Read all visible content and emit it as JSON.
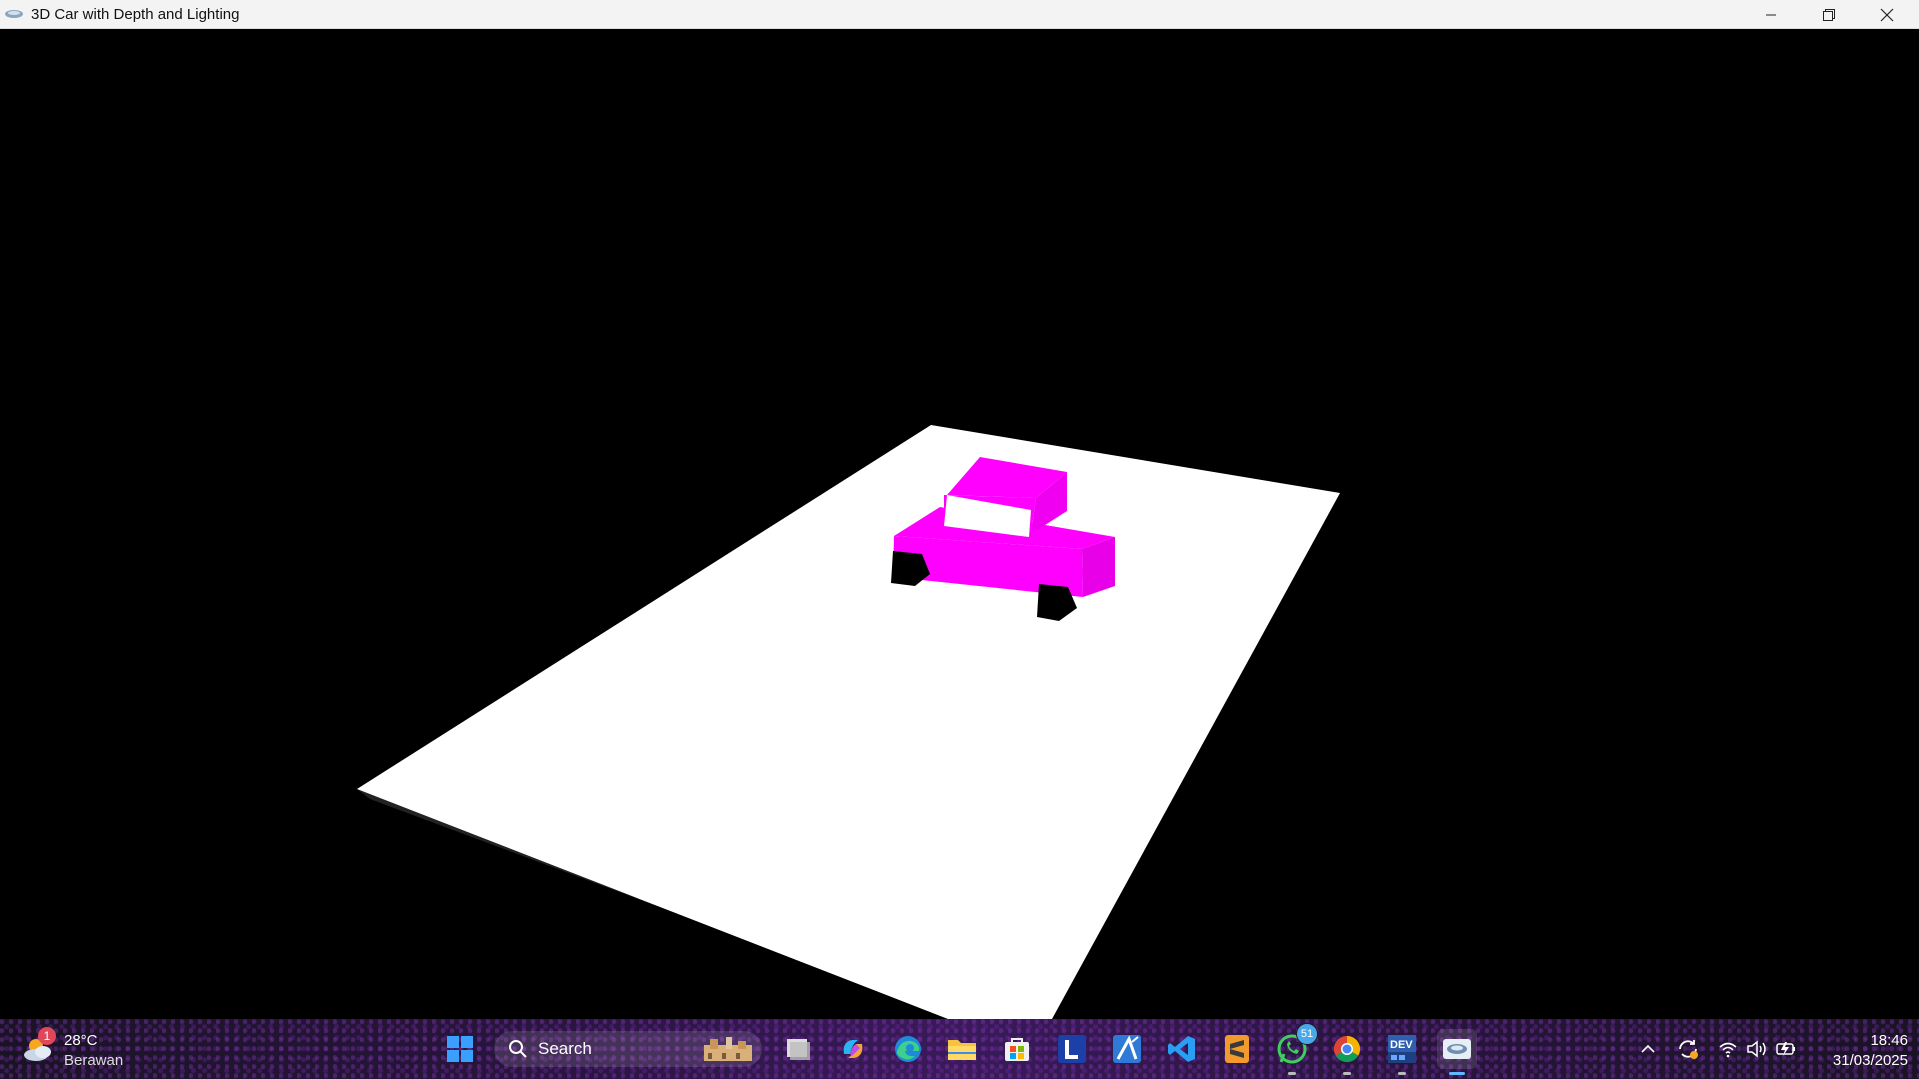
{
  "window": {
    "title": "3D Car with Depth and Lighting"
  },
  "scene": {
    "ground_color": "#ffffff",
    "car_color": "#ff00ff",
    "wheel_color": "#000000",
    "background_color": "#000000"
  },
  "taskbar": {
    "weather": {
      "temperature": "28°C",
      "description": "Berawan",
      "badge": "1"
    },
    "search": {
      "label": "Search"
    },
    "pinned": [
      {
        "name": "start-button-icon"
      },
      {
        "name": "task-view-icon"
      },
      {
        "name": "copilot-icon"
      },
      {
        "name": "edge-icon"
      },
      {
        "name": "file-explorer-icon"
      },
      {
        "name": "microsoft-store-icon"
      },
      {
        "name": "l-app-icon"
      },
      {
        "name": "drawing-app-icon"
      },
      {
        "name": "vscode-icon"
      },
      {
        "name": "sublime-text-icon"
      },
      {
        "name": "whatsapp-icon",
        "badge": "51"
      },
      {
        "name": "chrome-icon"
      },
      {
        "name": "dev-cpp-icon"
      },
      {
        "name": "opengl-app-icon"
      }
    ],
    "clock": {
      "time": "18:46",
      "date": "31/03/2025"
    },
    "dev_label": "DEV"
  }
}
